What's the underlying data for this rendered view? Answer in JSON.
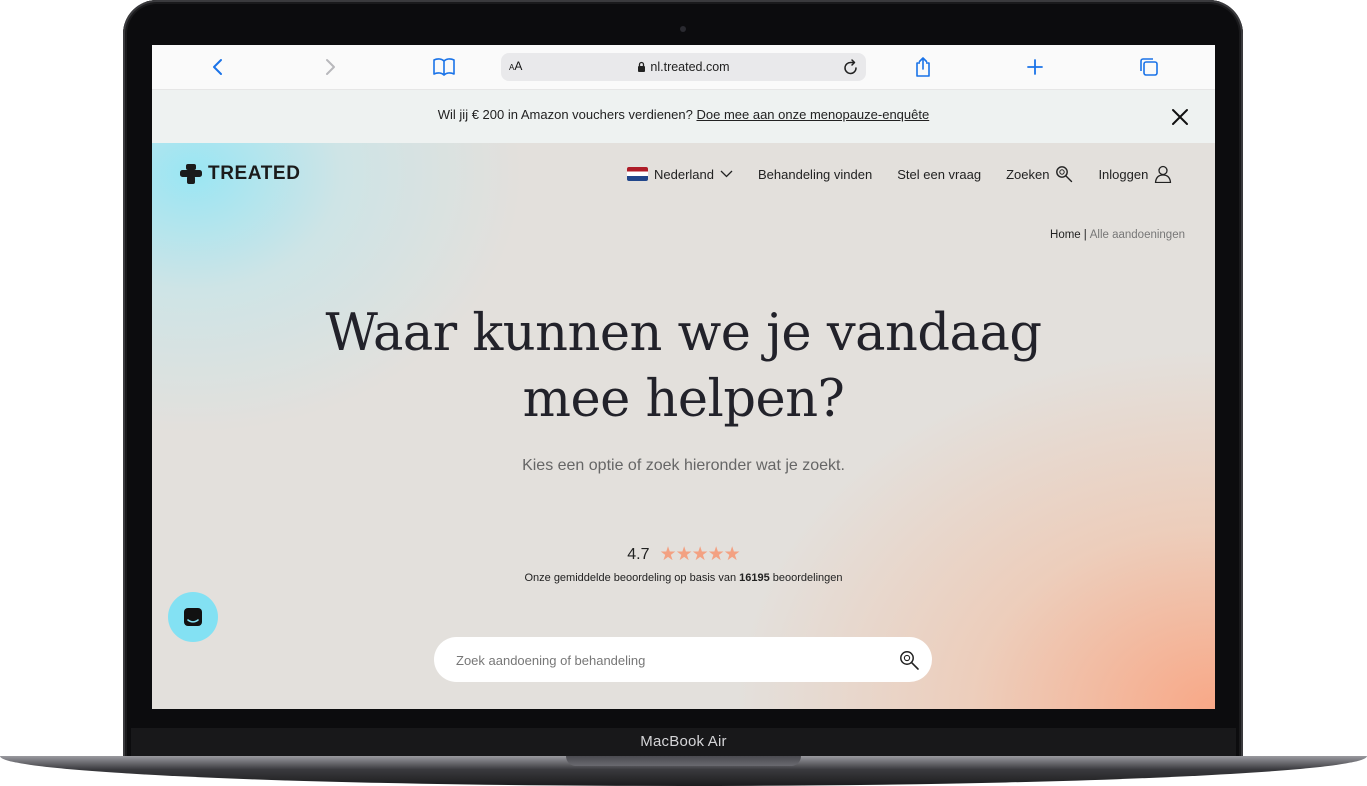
{
  "device": {
    "model_label": "MacBook Air"
  },
  "browser": {
    "aa_label": "AA",
    "url": "nl.treated.com",
    "icons": [
      "back-icon",
      "forward-icon",
      "bookmarks-icon",
      "lock-icon",
      "reload-icon",
      "share-icon",
      "new-tab-icon",
      "tabs-icon"
    ]
  },
  "announcement": {
    "text": "Wil jij € 200 in Amazon vouchers verdienen?",
    "link": "Doe mee aan onze menopauze-enquête"
  },
  "header": {
    "logo": "TREATED",
    "nav": {
      "country": "Nederland",
      "find_treatment": "Behandeling vinden",
      "ask_question": "Stel een vraag",
      "search": "Zoeken",
      "login": "Inloggen"
    }
  },
  "breadcrumb": {
    "home": "Home",
    "separator": "|",
    "current": "Alle aandoeningen"
  },
  "hero": {
    "title_line1": "Waar kunnen we je vandaag",
    "title_line2": "mee helpen?",
    "subtitle": "Kies een optie of zoek hieronder wat je zoekt."
  },
  "rating": {
    "score": "4.7",
    "stars": 5,
    "stars_text": "★★★★★",
    "text_before": "Onze gemiddelde beoordeling op basis van",
    "count": "16195",
    "text_after": "beoordelingen"
  },
  "search": {
    "placeholder": "Zoek aandoening of behandeling"
  },
  "colors": {
    "accent_star": "#f3a182",
    "chat_bubble": "#83e1f3",
    "text": "#22222a"
  }
}
